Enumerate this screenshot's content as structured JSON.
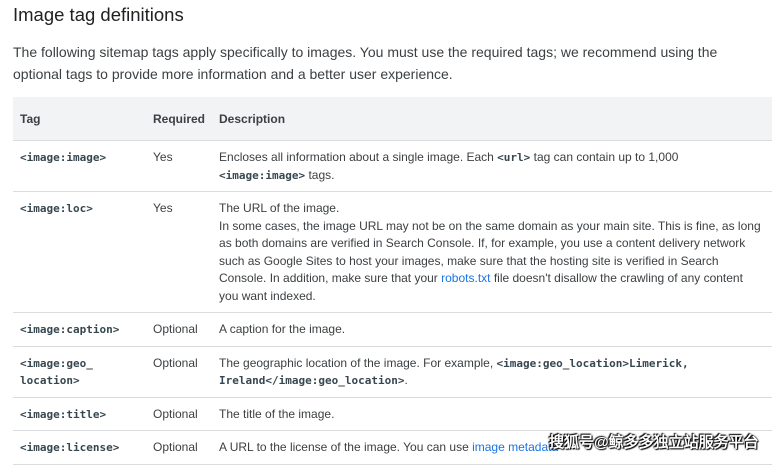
{
  "heading": "Image tag definitions",
  "intro": "The following sitemap tags apply specifically to images. You must use the required tags; we recommend using the optional tags to provide more information and a better user experience.",
  "table": {
    "headers": {
      "tag": "Tag",
      "required": "Required",
      "description": "Description"
    },
    "rows": [
      {
        "tag": "<image:image>",
        "required": "Yes",
        "desc1": "Encloses all information about a single image. Each ",
        "code1": "<url>",
        "desc2": " tag can contain up to 1,000 ",
        "code2": "<image:image>",
        "desc3": " tags."
      },
      {
        "tag": "<image:loc>",
        "required": "Yes",
        "line1": "The URL of the image.",
        "desc1": "In some cases, the image URL may not be on the same domain as your main site. This is fine, as long as both domains are verified in Search Console. If, for example, you use a content delivery network such as Google Sites to host your images, make sure that the hosting site is verified in Search Console. In addition, make sure that your ",
        "link": "robots.txt",
        "desc2": " file doesn't disallow the crawling of any content you want indexed."
      },
      {
        "tag": "<image:caption>",
        "required": "Optional",
        "desc": "A caption for the image."
      },
      {
        "tag_line1": "<image:geo_",
        "tag_line2": "location>",
        "required": "Optional",
        "desc1": "The geographic location of the image. For example, ",
        "code": "<image:geo_location>Limerick, Ireland</image:geo_location>",
        "desc2": "."
      },
      {
        "tag": "<image:title>",
        "required": "Optional",
        "desc": "The title of the image."
      },
      {
        "tag": "<image:license>",
        "required": "Optional",
        "desc1": "A URL to the license of the image. You can use ",
        "link": "image metadata"
      }
    ]
  },
  "watermark": "搜狐号@鲸多多独立站服务平台"
}
